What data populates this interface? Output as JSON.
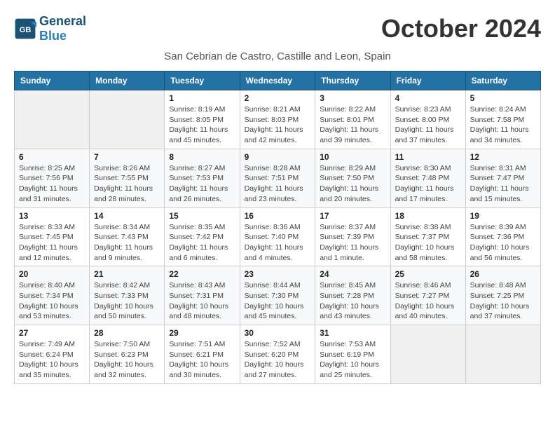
{
  "header": {
    "logo_general": "General",
    "logo_blue": "Blue",
    "month_title": "October 2024",
    "location": "San Cebrian de Castro, Castille and Leon, Spain"
  },
  "weekdays": [
    "Sunday",
    "Monday",
    "Tuesday",
    "Wednesday",
    "Thursday",
    "Friday",
    "Saturday"
  ],
  "weeks": [
    [
      {
        "day": "",
        "sunrise": "",
        "sunset": "",
        "daylight": ""
      },
      {
        "day": "",
        "sunrise": "",
        "sunset": "",
        "daylight": ""
      },
      {
        "day": "1",
        "sunrise": "Sunrise: 8:19 AM",
        "sunset": "Sunset: 8:05 PM",
        "daylight": "Daylight: 11 hours and 45 minutes."
      },
      {
        "day": "2",
        "sunrise": "Sunrise: 8:21 AM",
        "sunset": "Sunset: 8:03 PM",
        "daylight": "Daylight: 11 hours and 42 minutes."
      },
      {
        "day": "3",
        "sunrise": "Sunrise: 8:22 AM",
        "sunset": "Sunset: 8:01 PM",
        "daylight": "Daylight: 11 hours and 39 minutes."
      },
      {
        "day": "4",
        "sunrise": "Sunrise: 8:23 AM",
        "sunset": "Sunset: 8:00 PM",
        "daylight": "Daylight: 11 hours and 37 minutes."
      },
      {
        "day": "5",
        "sunrise": "Sunrise: 8:24 AM",
        "sunset": "Sunset: 7:58 PM",
        "daylight": "Daylight: 11 hours and 34 minutes."
      }
    ],
    [
      {
        "day": "6",
        "sunrise": "Sunrise: 8:25 AM",
        "sunset": "Sunset: 7:56 PM",
        "daylight": "Daylight: 11 hours and 31 minutes."
      },
      {
        "day": "7",
        "sunrise": "Sunrise: 8:26 AM",
        "sunset": "Sunset: 7:55 PM",
        "daylight": "Daylight: 11 hours and 28 minutes."
      },
      {
        "day": "8",
        "sunrise": "Sunrise: 8:27 AM",
        "sunset": "Sunset: 7:53 PM",
        "daylight": "Daylight: 11 hours and 26 minutes."
      },
      {
        "day": "9",
        "sunrise": "Sunrise: 8:28 AM",
        "sunset": "Sunset: 7:51 PM",
        "daylight": "Daylight: 11 hours and 23 minutes."
      },
      {
        "day": "10",
        "sunrise": "Sunrise: 8:29 AM",
        "sunset": "Sunset: 7:50 PM",
        "daylight": "Daylight: 11 hours and 20 minutes."
      },
      {
        "day": "11",
        "sunrise": "Sunrise: 8:30 AM",
        "sunset": "Sunset: 7:48 PM",
        "daylight": "Daylight: 11 hours and 17 minutes."
      },
      {
        "day": "12",
        "sunrise": "Sunrise: 8:31 AM",
        "sunset": "Sunset: 7:47 PM",
        "daylight": "Daylight: 11 hours and 15 minutes."
      }
    ],
    [
      {
        "day": "13",
        "sunrise": "Sunrise: 8:33 AM",
        "sunset": "Sunset: 7:45 PM",
        "daylight": "Daylight: 11 hours and 12 minutes."
      },
      {
        "day": "14",
        "sunrise": "Sunrise: 8:34 AM",
        "sunset": "Sunset: 7:43 PM",
        "daylight": "Daylight: 11 hours and 9 minutes."
      },
      {
        "day": "15",
        "sunrise": "Sunrise: 8:35 AM",
        "sunset": "Sunset: 7:42 PM",
        "daylight": "Daylight: 11 hours and 6 minutes."
      },
      {
        "day": "16",
        "sunrise": "Sunrise: 8:36 AM",
        "sunset": "Sunset: 7:40 PM",
        "daylight": "Daylight: 11 hours and 4 minutes."
      },
      {
        "day": "17",
        "sunrise": "Sunrise: 8:37 AM",
        "sunset": "Sunset: 7:39 PM",
        "daylight": "Daylight: 11 hours and 1 minute."
      },
      {
        "day": "18",
        "sunrise": "Sunrise: 8:38 AM",
        "sunset": "Sunset: 7:37 PM",
        "daylight": "Daylight: 10 hours and 58 minutes."
      },
      {
        "day": "19",
        "sunrise": "Sunrise: 8:39 AM",
        "sunset": "Sunset: 7:36 PM",
        "daylight": "Daylight: 10 hours and 56 minutes."
      }
    ],
    [
      {
        "day": "20",
        "sunrise": "Sunrise: 8:40 AM",
        "sunset": "Sunset: 7:34 PM",
        "daylight": "Daylight: 10 hours and 53 minutes."
      },
      {
        "day": "21",
        "sunrise": "Sunrise: 8:42 AM",
        "sunset": "Sunset: 7:33 PM",
        "daylight": "Daylight: 10 hours and 50 minutes."
      },
      {
        "day": "22",
        "sunrise": "Sunrise: 8:43 AM",
        "sunset": "Sunset: 7:31 PM",
        "daylight": "Daylight: 10 hours and 48 minutes."
      },
      {
        "day": "23",
        "sunrise": "Sunrise: 8:44 AM",
        "sunset": "Sunset: 7:30 PM",
        "daylight": "Daylight: 10 hours and 45 minutes."
      },
      {
        "day": "24",
        "sunrise": "Sunrise: 8:45 AM",
        "sunset": "Sunset: 7:28 PM",
        "daylight": "Daylight: 10 hours and 43 minutes."
      },
      {
        "day": "25",
        "sunrise": "Sunrise: 8:46 AM",
        "sunset": "Sunset: 7:27 PM",
        "daylight": "Daylight: 10 hours and 40 minutes."
      },
      {
        "day": "26",
        "sunrise": "Sunrise: 8:48 AM",
        "sunset": "Sunset: 7:25 PM",
        "daylight": "Daylight: 10 hours and 37 minutes."
      }
    ],
    [
      {
        "day": "27",
        "sunrise": "Sunrise: 7:49 AM",
        "sunset": "Sunset: 6:24 PM",
        "daylight": "Daylight: 10 hours and 35 minutes."
      },
      {
        "day": "28",
        "sunrise": "Sunrise: 7:50 AM",
        "sunset": "Sunset: 6:23 PM",
        "daylight": "Daylight: 10 hours and 32 minutes."
      },
      {
        "day": "29",
        "sunrise": "Sunrise: 7:51 AM",
        "sunset": "Sunset: 6:21 PM",
        "daylight": "Daylight: 10 hours and 30 minutes."
      },
      {
        "day": "30",
        "sunrise": "Sunrise: 7:52 AM",
        "sunset": "Sunset: 6:20 PM",
        "daylight": "Daylight: 10 hours and 27 minutes."
      },
      {
        "day": "31",
        "sunrise": "Sunrise: 7:53 AM",
        "sunset": "Sunset: 6:19 PM",
        "daylight": "Daylight: 10 hours and 25 minutes."
      },
      {
        "day": "",
        "sunrise": "",
        "sunset": "",
        "daylight": ""
      },
      {
        "day": "",
        "sunrise": "",
        "sunset": "",
        "daylight": ""
      }
    ]
  ]
}
